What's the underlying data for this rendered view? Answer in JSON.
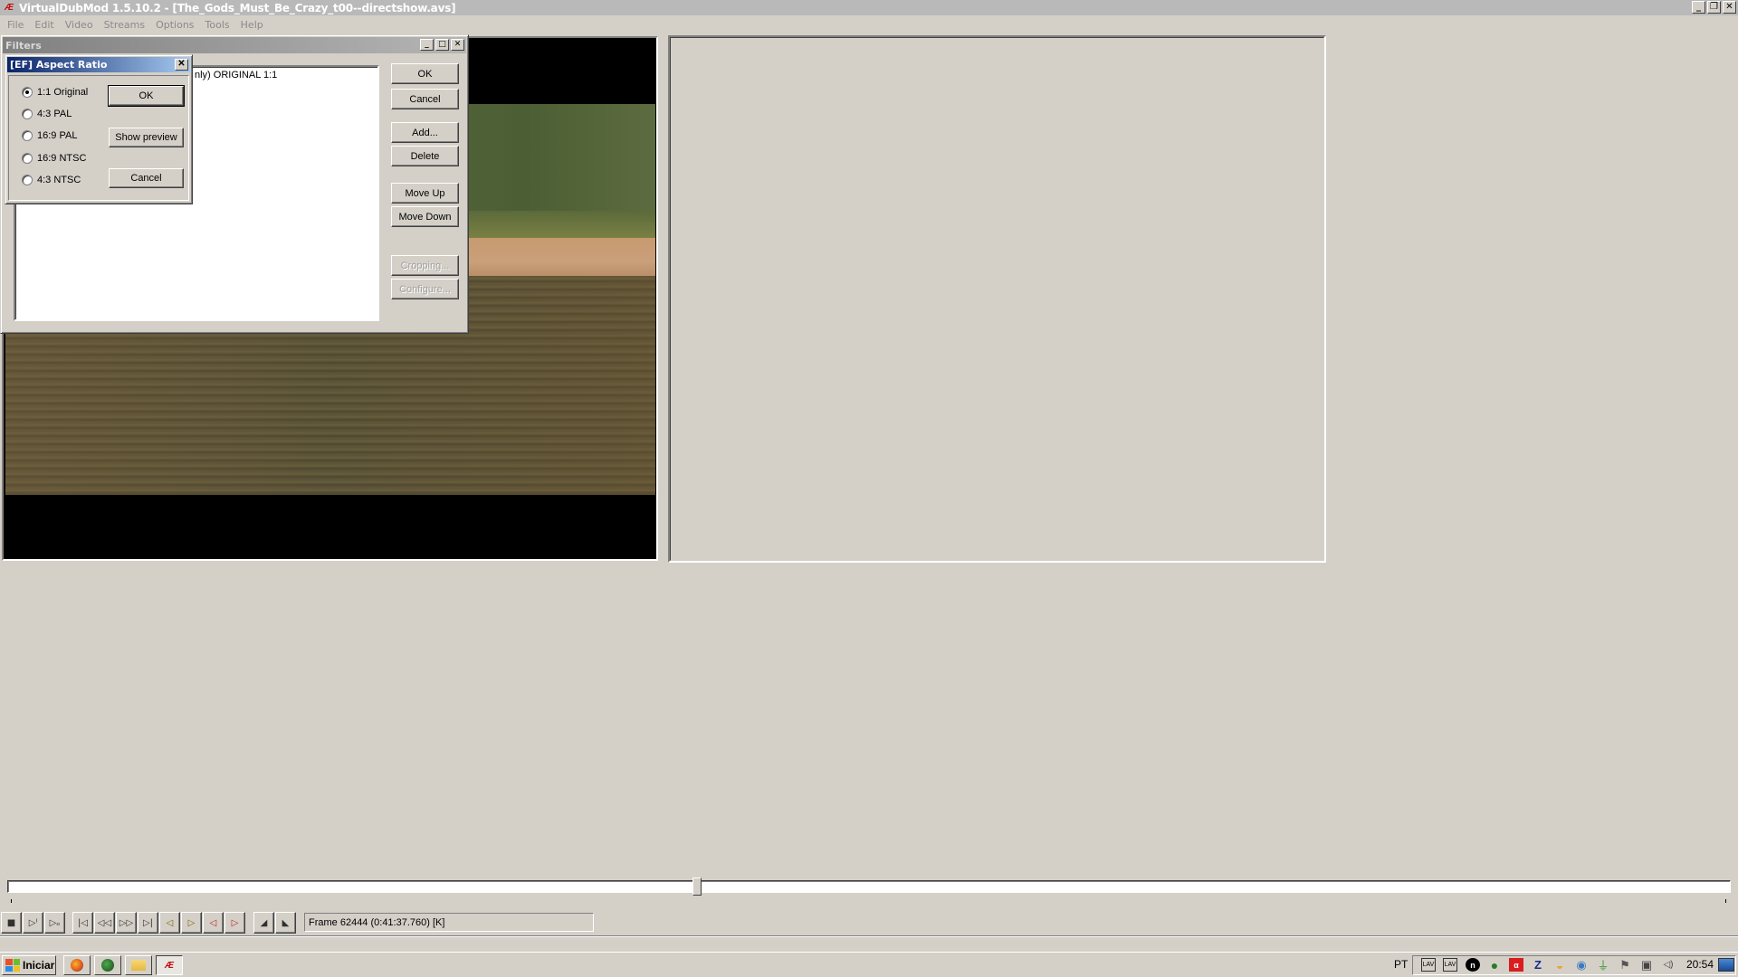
{
  "window": {
    "title": "VirtualDubMod 1.5.10.2 - [The_Gods_Must_Be_Crazy_t00--directshow.avs]",
    "app_icon": "virtualdub-logo-icon",
    "controls": {
      "minimize": "_",
      "restore": "❐",
      "close": "✕"
    }
  },
  "menubar": {
    "items": [
      "File",
      "Edit",
      "Video",
      "Streams",
      "Options",
      "Tools",
      "Help"
    ]
  },
  "filters_dialog": {
    "title": "Filters",
    "controls": {
      "minimize": "_",
      "maximize": "□",
      "close": "✕"
    },
    "filter_list": {
      "entries": [
        "nly)  ORIGINAL 1:1"
      ]
    },
    "buttons": {
      "ok": "OK",
      "cancel": "Cancel",
      "add": "Add...",
      "delete": "Delete",
      "move_up": "Move Up",
      "move_down": "Move Down",
      "cropping": "Cropping...",
      "configure": "Configure..."
    }
  },
  "aspect_ratio_dialog": {
    "title": "[EF] Aspect Ratio",
    "close": "✕",
    "options": [
      {
        "label": "1:1 Original",
        "checked": true
      },
      {
        "label": "4:3 PAL",
        "checked": false
      },
      {
        "label": "16:9 PAL",
        "checked": false
      },
      {
        "label": "16:9 NTSC",
        "checked": false
      },
      {
        "label": "4:3 NTSC",
        "checked": false
      }
    ],
    "buttons": {
      "ok": "OK",
      "show_preview": "Show preview",
      "cancel": "Cancel"
    }
  },
  "timeline": {
    "position_fraction": 0.4
  },
  "toolbar": {
    "buttons": [
      {
        "name": "stop-icon",
        "glyph": "■"
      },
      {
        "name": "play-input-icon",
        "glyph": "▷ᴵ"
      },
      {
        "name": "play-output-icon",
        "glyph": "▷ₒ"
      },
      {
        "name": "go-start-icon",
        "glyph": "|◁"
      },
      {
        "name": "prev-key-icon",
        "glyph": "◁◁"
      },
      {
        "name": "next-key-icon",
        "glyph": "▷▷"
      },
      {
        "name": "go-end-icon",
        "glyph": "▷|"
      },
      {
        "name": "prev-keyframe-icon",
        "glyph": "◁"
      },
      {
        "name": "next-keyframe-icon",
        "glyph": "▷"
      },
      {
        "name": "prev-scene-icon",
        "glyph": "◁"
      },
      {
        "name": "next-scene-icon",
        "glyph": "▷"
      },
      {
        "name": "mark-in-icon",
        "glyph": "◢"
      },
      {
        "name": "mark-out-icon",
        "glyph": "◣"
      }
    ],
    "frame_info": "Frame 62444 (0:41:37.760) [K]"
  },
  "taskbar": {
    "start_label": "Iniciar",
    "quick_launch": [
      "firefox-icon",
      "globe-app-icon",
      "folder-icon",
      "virtualdub-icon"
    ],
    "language": "PT",
    "tray_icons": [
      "lav-audio-icon",
      "lav-video-icon",
      "n-icon",
      "globe-tray-icon",
      "avira-icon",
      "z-icon",
      "disc-icon",
      "network-app-icon",
      "power-icon",
      "action-center-flag-icon",
      "network-icon",
      "volume-icon"
    ],
    "tray_glyphs": [
      "LAV",
      "LAV",
      "n",
      "●",
      "α",
      "Z",
      "◒",
      "◉",
      "⏚",
      "⚑",
      "▣",
      "◁)"
    ],
    "clock": "20:54",
    "show_desktop": "show-desktop-icon"
  },
  "colors": {
    "title_active": "#0a246a",
    "title_active_end": "#a6caf0",
    "title_inactive": "#808080",
    "face": "#d4d0c8"
  }
}
